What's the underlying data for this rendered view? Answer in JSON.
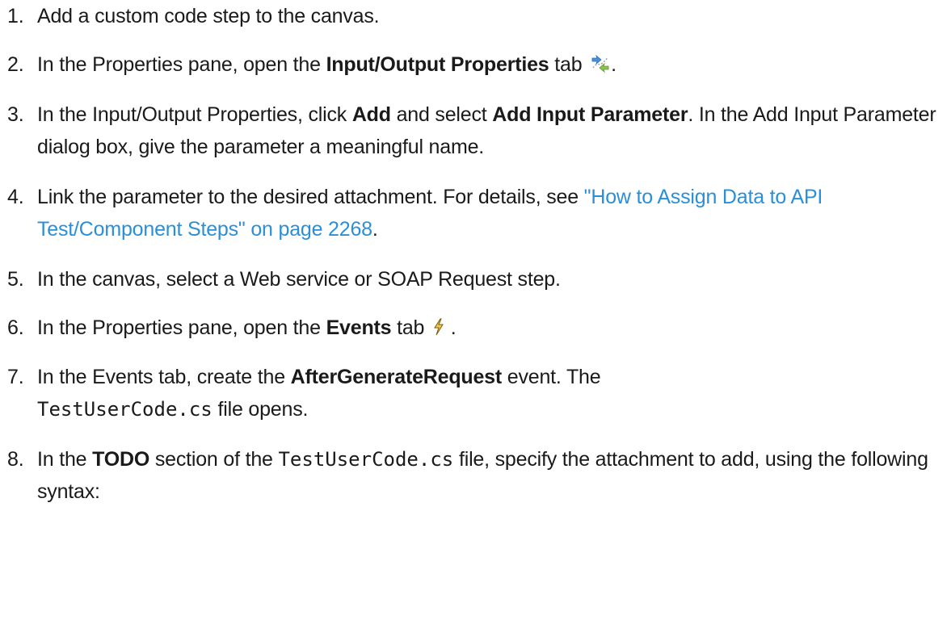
{
  "steps": [
    {
      "num": "1.",
      "parts": [
        {
          "t": "Add a custom code step to the canvas."
        }
      ]
    },
    {
      "num": "2.",
      "parts": [
        {
          "t": "In the Properties pane, open the "
        },
        {
          "t": "Input/Output Properties",
          "b": true
        },
        {
          "t": " tab "
        },
        {
          "icon": "input-output-properties-icon"
        },
        {
          "t": "."
        }
      ]
    },
    {
      "num": "3.",
      "parts": [
        {
          "t": "In the Input/Output Properties, click "
        },
        {
          "t": "Add",
          "b": true
        },
        {
          "t": " and select "
        },
        {
          "t": "Add Input Parameter",
          "b": true
        },
        {
          "t": ". In the Add Input Parameter dialog box, give the parameter a meaningful name."
        }
      ]
    },
    {
      "num": "4.",
      "parts": [
        {
          "t": "Link the parameter to the desired attachment. For details, see "
        },
        {
          "t": "\"How to Assign Data to API Test/Component Steps\" on page 2268",
          "link": true
        },
        {
          "t": "."
        }
      ]
    },
    {
      "num": "5.",
      "parts": [
        {
          "t": "In the canvas, select a Web service or SOAP Request step."
        }
      ]
    },
    {
      "num": "6.",
      "parts": [
        {
          "t": "In the Properties pane, open the "
        },
        {
          "t": "Events",
          "b": true
        },
        {
          "t": " tab "
        },
        {
          "icon": "lightning-events-icon"
        },
        {
          "t": " ."
        }
      ]
    },
    {
      "num": "7.",
      "parts": [
        {
          "t": "In the Events tab, create the "
        },
        {
          "t": "AfterGenerateRequest",
          "b": true
        },
        {
          "t": " event. The "
        },
        {
          "t": "TestUserCode.cs",
          "code": true
        },
        {
          "t": " file opens."
        }
      ]
    },
    {
      "num": "8.",
      "parts": [
        {
          "t": "In the "
        },
        {
          "t": "TODO",
          "b": true
        },
        {
          "t": " section of the "
        },
        {
          "t": "TestUserCode.cs",
          "code": true
        },
        {
          "t": " file, specify the attachment to add, using the following syntax:"
        }
      ]
    }
  ]
}
